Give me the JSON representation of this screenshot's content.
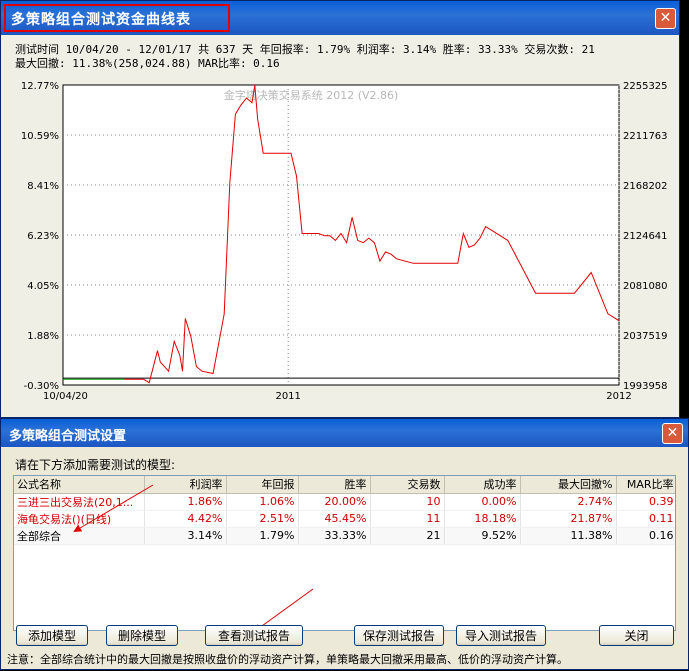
{
  "window1": {
    "title": "多策略组合测试资金曲线表",
    "stats_line1": "测试时间 10/04/20 - 12/01/17 共 637 天 年回报率: 1.79% 利润率: 3.14% 胜率: 33.33% 交易次数: 21",
    "stats_line2": "最大回撤: 11.38%(258,024.88) MAR比率: 0.16",
    "watermark": "金字塔决策交易系统 2012 (V2.86)",
    "close_glyph": "✕"
  },
  "chart_data": {
    "type": "line",
    "y_left_ticks": [
      "12.77%",
      "10.59%",
      "8.41%",
      "6.23%",
      "4.05%",
      "1.88%",
      "-0.30%"
    ],
    "y_right_ticks": [
      "2255325",
      "2211763",
      "2168202",
      "2124641",
      "2081080",
      "2037519",
      "1993958"
    ],
    "ylim_pct": [
      -0.3,
      12.77
    ],
    "x_tick_labels": [
      "10/04/20",
      "2011",
      "2012"
    ],
    "series": [
      {
        "color": "#00a000",
        "x": [
          0.0,
          0.11
        ],
        "y": [
          -0.05,
          -0.05
        ]
      },
      {
        "color": "#e00000",
        "x": [
          0.11,
          0.145,
          0.155,
          0.17,
          0.175,
          0.19,
          0.2,
          0.21,
          0.215,
          0.22,
          0.23,
          0.24,
          0.25,
          0.27,
          0.29,
          0.3,
          0.31,
          0.32,
          0.33,
          0.34,
          0.345,
          0.35,
          0.36,
          0.37,
          0.375,
          0.38,
          0.39,
          0.4,
          0.41,
          0.42,
          0.43,
          0.44,
          0.45,
          0.46,
          0.47,
          0.48,
          0.49,
          0.5,
          0.51,
          0.52,
          0.53,
          0.54,
          0.55,
          0.56,
          0.57,
          0.58,
          0.59,
          0.6,
          0.63,
          0.66,
          0.68,
          0.69,
          0.7,
          0.71,
          0.72,
          0.73,
          0.74,
          0.75,
          0.76,
          0.8,
          0.85,
          0.87,
          0.88,
          0.89,
          0.9,
          0.91,
          0.92,
          0.95,
          0.98,
          1.0
        ],
        "y": [
          -0.05,
          -0.05,
          -0.2,
          1.2,
          0.7,
          0.3,
          1.6,
          1.0,
          0.3,
          2.6,
          1.8,
          0.5,
          0.3,
          0.2,
          2.8,
          8.5,
          11.5,
          11.9,
          12.2,
          12.0,
          12.77,
          11.3,
          9.8,
          9.8,
          9.8,
          9.8,
          9.8,
          9.8,
          9.8,
          8.8,
          6.3,
          6.3,
          6.3,
          6.3,
          6.2,
          6.2,
          6.0,
          6.3,
          5.9,
          7.0,
          6.0,
          5.9,
          6.1,
          5.9,
          5.1,
          5.5,
          5.4,
          5.2,
          5.0,
          5.0,
          5.0,
          5.0,
          5.0,
          5.0,
          6.3,
          5.7,
          5.8,
          6.1,
          6.6,
          6.0,
          3.7,
          3.7,
          3.7,
          3.7,
          3.7,
          3.7,
          3.7,
          4.6,
          2.8,
          2.5
        ]
      }
    ]
  },
  "window2": {
    "title": "多策略组合测试设置",
    "close_glyph": "✕",
    "instruction": "请在下方添加需要测试的模型:",
    "columns": [
      "公式名称",
      "利润率",
      "年回报",
      "胜率",
      "交易数",
      "成功率",
      "最大回撤%",
      "MAR比率"
    ],
    "rows": [
      [
        "三进三出交易法(20,1...",
        "1.86%",
        "1.06%",
        "20.00%",
        "10",
        "0.00%",
        "2.74%",
        "0.39"
      ],
      [
        "海龟交易法()(日线)",
        "4.42%",
        "2.51%",
        "45.45%",
        "11",
        "18.18%",
        "21.87%",
        "0.11"
      ],
      [
        "全部综合",
        "3.14%",
        "1.79%",
        "33.33%",
        "21",
        "9.52%",
        "11.38%",
        "0.16"
      ]
    ],
    "buttons": {
      "add": "添加模型",
      "delete": "删除模型",
      "view": "查看测试报告",
      "save": "保存测试报告",
      "import": "导入测试报告",
      "close": "关闭"
    },
    "note": "注意：全部综合统计中的最大回撤是按照收盘价的浮动资产计算，单策略最大回撤采用最高、低价的浮动资产计算。"
  }
}
